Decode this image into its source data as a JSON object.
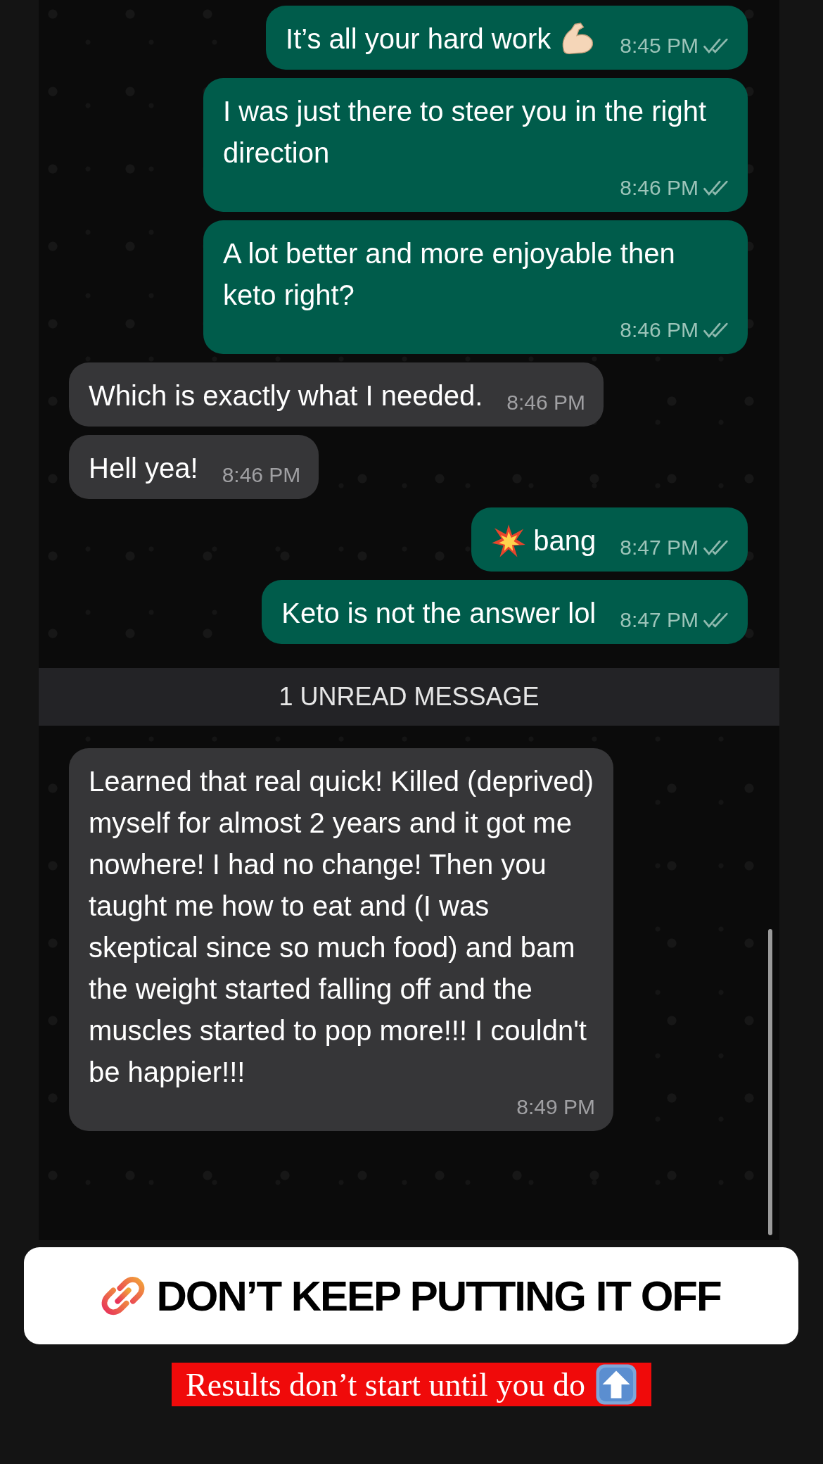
{
  "messages": [
    {
      "kind": "outgoing",
      "text": "It’s all your hard work",
      "trail_icon": {
        "kind": "muscle"
      },
      "time": "8:45 PM"
    },
    {
      "kind": "outgoing",
      "text": "I was just there to steer you in the right direction",
      "time": "8:46 PM"
    },
    {
      "kind": "outgoing",
      "text": "A lot better and more enjoyable then keto right?",
      "time": "8:46 PM"
    },
    {
      "kind": "incoming",
      "text": "Which is exactly what I needed.",
      "time": "8:46 PM"
    },
    {
      "kind": "incoming",
      "text": "Hell yea!",
      "time": "8:46 PM"
    },
    {
      "kind": "outgoing",
      "text": "bang",
      "lead_icon": {
        "kind": "explosion"
      },
      "time": "8:47 PM"
    },
    {
      "kind": "outgoing",
      "text": "Keto is not the answer lol",
      "time": "8:47 PM"
    },
    {
      "kind": "banner",
      "text": "1 UNREAD MESSAGE"
    },
    {
      "kind": "incoming",
      "text": "Learned that real quick! Killed (deprived) myself for almost 2 years and it got me nowhere! I had no change! Then you taught me how to eat and (I was skeptical since so much food) and bam the weight started falling off and the muscles started to pop more!!! I couldn't be happier!!!",
      "time": "8:49 PM"
    }
  ],
  "sticker": {
    "icon": {
      "kind": "link"
    },
    "text": "DON’T KEEP PUTTING IT OFF"
  },
  "caption": {
    "text": "Results don’t start until you do",
    "icon": {
      "kind": "up-arrow"
    }
  }
}
